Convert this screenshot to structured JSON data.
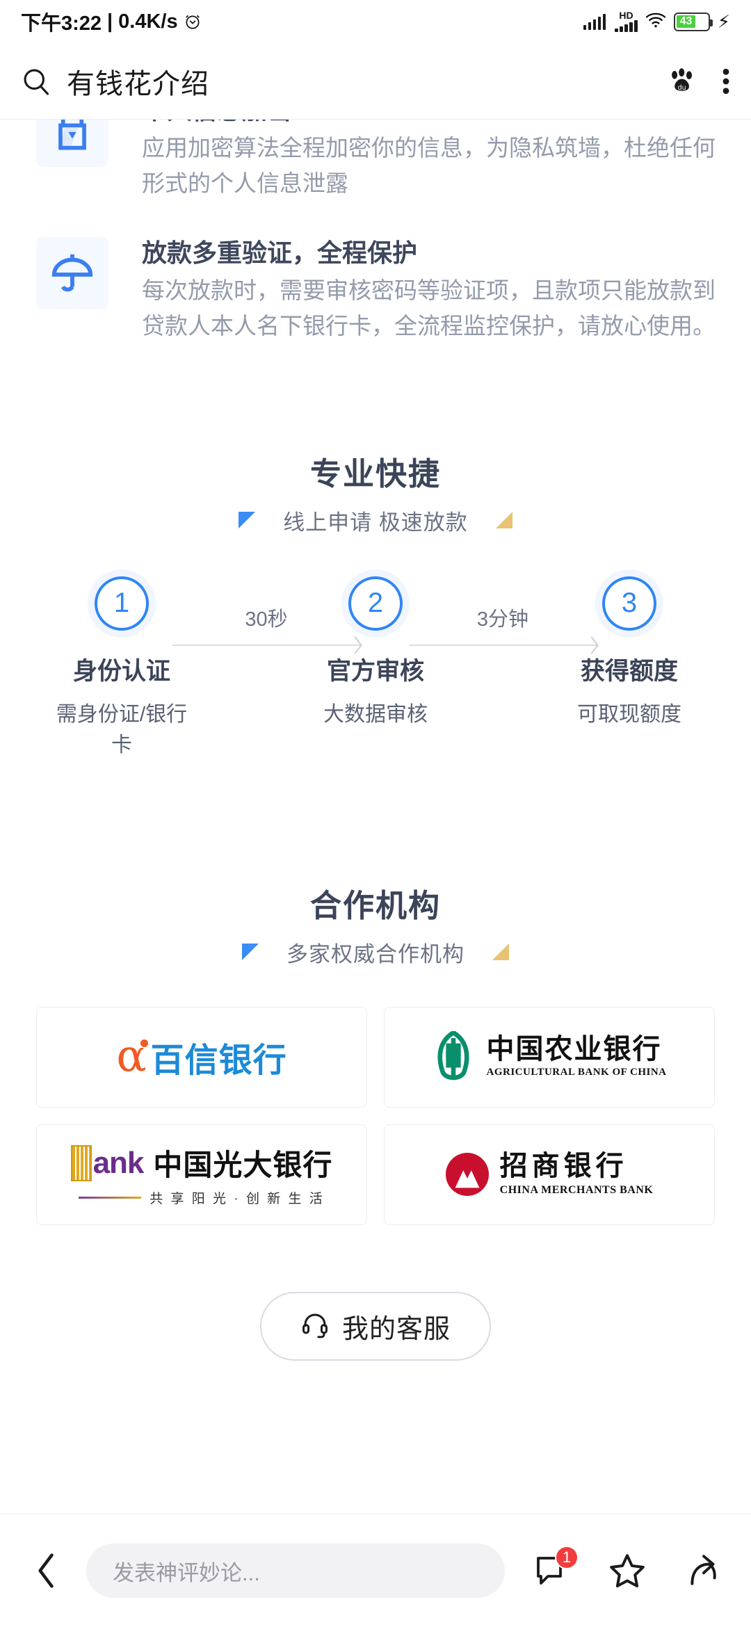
{
  "status_bar": {
    "time": "下午3:22",
    "separator": "|",
    "network_speed": "0.4K/s",
    "alarm_icon": "alarm-clock-icon",
    "signal_icon": "signal-bars-icon",
    "hd_label": "HD",
    "wifi_icon": "wifi-icon",
    "battery_level": "43",
    "charging_icon": "lightning-bolt-icon"
  },
  "header": {
    "search_icon": "search-icon",
    "title": "有钱花介绍",
    "baidu_icon": "baidu-paw-icon",
    "menu_icon": "more-vertical-icon"
  },
  "features": [
    {
      "icon": "lock-icon",
      "title": "个人信息加密",
      "desc": "应用加密算法全程加密你的信息，为隐私筑墙，杜绝任何形式的个人信息泄露"
    },
    {
      "icon": "umbrella-icon",
      "title": "放款多重验证，全程保护",
      "desc": "每次放款时，需要审核密码等验证项，且款项只能放款到贷款人本人名下银行卡，全流程监控保护，请放心使用。"
    }
  ],
  "process_section": {
    "title": "专业快捷",
    "subtitle": "线上申请 极速放款",
    "left_marker_color": "#2f86f6",
    "right_marker_color": "#e8c06a",
    "steps": [
      {
        "number": "1",
        "name": "身份认证",
        "desc": "需身份证/银行卡"
      },
      {
        "number": "2",
        "name": "官方审核",
        "desc": "大数据审核"
      },
      {
        "number": "3",
        "name": "获得额度",
        "desc": "可取现额度"
      }
    ],
    "connectors": [
      {
        "label": "30秒"
      },
      {
        "label": "3分钟"
      }
    ]
  },
  "partners_section": {
    "title": "合作机构",
    "subtitle": "多家权威合作机构",
    "banks": [
      {
        "name_cn": "百信银行",
        "name_en": "",
        "mark": "alpha-mark",
        "color": "#1d8ad6",
        "mark_color": "#f15a22"
      },
      {
        "name_cn": "中国农业银行",
        "name_en": "AGRICULTURAL BANK OF CHINA",
        "mark": "abc-ear-mark",
        "color": "#111111",
        "mark_color": "#0a8f6c"
      },
      {
        "name_cn": "中国光大银行",
        "name_en": "",
        "slogan": "共 享 阳 光 · 创 新 生 活",
        "mark": "bank-wordmark",
        "color": "#111111",
        "mark_color": "#6b2d8c"
      },
      {
        "name_cn": "招商银行",
        "name_en": "CHINA MERCHANTS BANK",
        "mark": "cmb-arrow-mark",
        "color": "#111111",
        "mark_color": "#c8102e"
      }
    ]
  },
  "service_button": {
    "icon": "headset-icon",
    "label": "我的客服"
  },
  "bottom_bar": {
    "back_icon": "chevron-left-icon",
    "comment_placeholder": "发表神评妙论...",
    "comment_icon": "comment-bubble-icon",
    "comment_badge": "1",
    "favorite_icon": "star-icon",
    "share_icon": "share-arrow-icon"
  }
}
